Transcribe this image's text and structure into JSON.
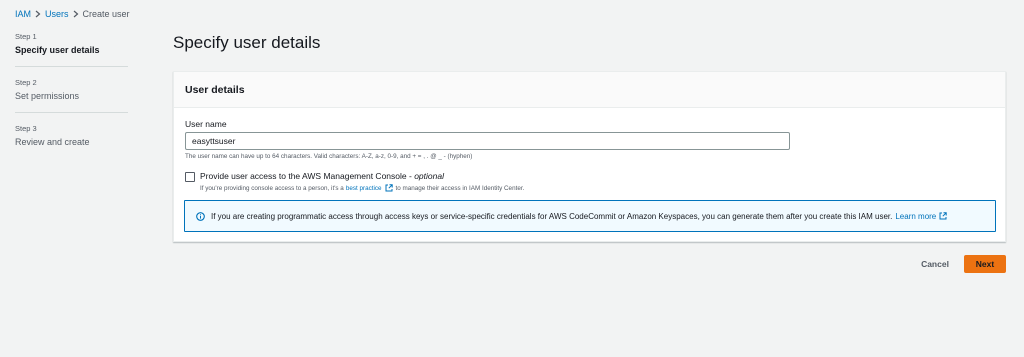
{
  "breadcrumb": {
    "items": [
      "IAM",
      "Users"
    ],
    "current": "Create user"
  },
  "steps": [
    {
      "number": "Step 1",
      "title": "Specify user details",
      "active": true
    },
    {
      "number": "Step 2",
      "title": "Set permissions",
      "active": false
    },
    {
      "number": "Step 3",
      "title": "Review and create",
      "active": false
    }
  ],
  "page": {
    "title": "Specify user details"
  },
  "panel": {
    "header": "User details",
    "user_name_label": "User name",
    "user_name_value": "easyttsuser",
    "user_name_hint": "The user name can have up to 64 characters. Valid characters: A-Z, a-z, 0-9, and + = , . @ _ - (hyphen)",
    "console_access_label": "Provide user access to the AWS Management Console - ",
    "console_access_optional": "optional",
    "console_access_checked": false,
    "console_desc_before": "If you're providing console access to a person, it's a",
    "console_desc_link": "best practice",
    "console_desc_after": "to manage their access in IAM Identity Center.",
    "info_text": "If you are creating programmatic access through access keys or service-specific credentials for AWS CodeCommit or Amazon Keyspaces, you can generate them after you create this IAM user.",
    "info_link": "Learn more"
  },
  "actions": {
    "cancel_label": "Cancel",
    "next_label": "Next"
  },
  "colors": {
    "link": "#0073bb",
    "primary_button": "#ec7211",
    "info_border": "#0073bb",
    "info_background": "#f1faff",
    "page_background": "#f2f3f3"
  },
  "icons": {
    "breadcrumb_separator": "chevron-right-icon",
    "external_link": "external-link-icon",
    "info": "info-icon"
  }
}
